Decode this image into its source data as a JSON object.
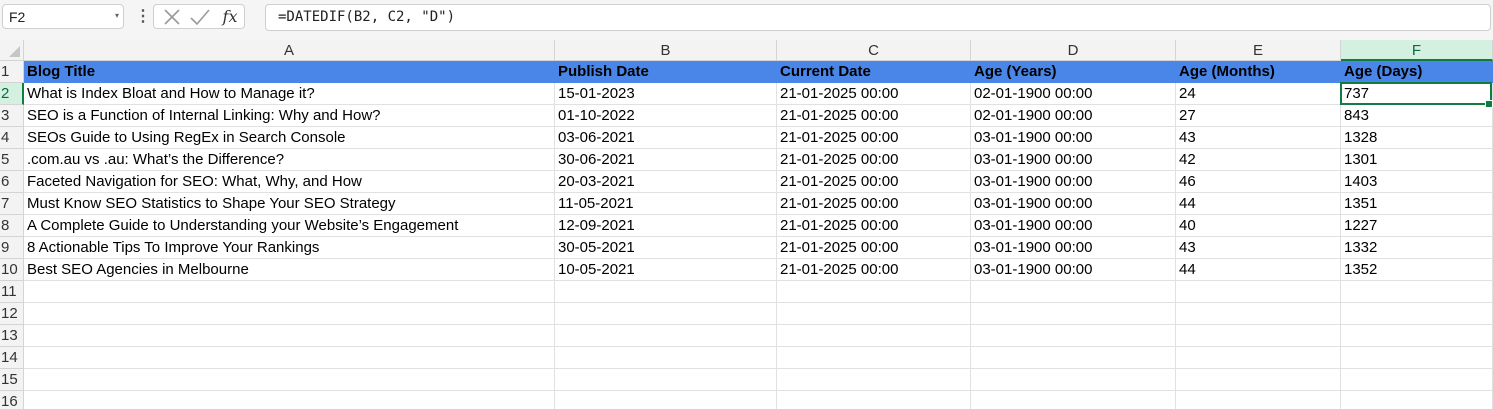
{
  "formula_bar": {
    "name_box": "F2",
    "fx_label": "fx",
    "formula": "=DATEDIF(B2, C2, \"D\")"
  },
  "columns": [
    "A",
    "B",
    "C",
    "D",
    "E",
    "F"
  ],
  "rows": [
    "1",
    "2",
    "3",
    "4",
    "5",
    "6",
    "7",
    "8",
    "9",
    "10",
    "11",
    "12",
    "13",
    "14",
    "15",
    "16"
  ],
  "header_row": [
    "Blog Title",
    "Publish Date",
    "Current Date",
    "Age (Years)",
    "Age (Months)",
    "Age (Days)"
  ],
  "data_rows": [
    [
      "What is Index Bloat and How to Manage it?",
      "15-01-2023",
      "21-01-2025 00:00",
      "02-01-1900 00:00",
      "24",
      "737"
    ],
    [
      "SEO is a Function of Internal Linking: Why and How?",
      "01-10-2022",
      "21-01-2025 00:00",
      "02-01-1900 00:00",
      "27",
      "843"
    ],
    [
      "SEOs Guide to Using RegEx in Search Console",
      "03-06-2021",
      "21-01-2025 00:00",
      "03-01-1900 00:00",
      "43",
      "1328"
    ],
    [
      ".com.au vs .au: What’s the Difference?",
      "30-06-2021",
      "21-01-2025 00:00",
      "03-01-1900 00:00",
      "42",
      "1301"
    ],
    [
      "Faceted Navigation for SEO: What, Why, and How",
      "20-03-2021",
      "21-01-2025 00:00",
      "03-01-1900 00:00",
      "46",
      "1403"
    ],
    [
      "Must Know SEO Statistics to Shape Your SEO Strategy",
      "11-05-2021",
      "21-01-2025 00:00",
      "03-01-1900 00:00",
      "44",
      "1351"
    ],
    [
      "A Complete Guide to Understanding your Website’s Engagement",
      "12-09-2021",
      "21-01-2025 00:00",
      "03-01-1900 00:00",
      "40",
      "1227"
    ],
    [
      "8 Actionable Tips To Improve Your Rankings",
      "30-05-2021",
      "21-01-2025 00:00",
      "03-01-1900 00:00",
      "43",
      "1332"
    ],
    [
      "Best SEO Agencies in Melbourne",
      "10-05-2021",
      "21-01-2025 00:00",
      "03-01-1900 00:00",
      "44",
      "1352"
    ]
  ],
  "active_cell": {
    "column": "F",
    "row": "2"
  },
  "colors": {
    "header_fill": "#4a86e8",
    "selection": "#107c41"
  }
}
